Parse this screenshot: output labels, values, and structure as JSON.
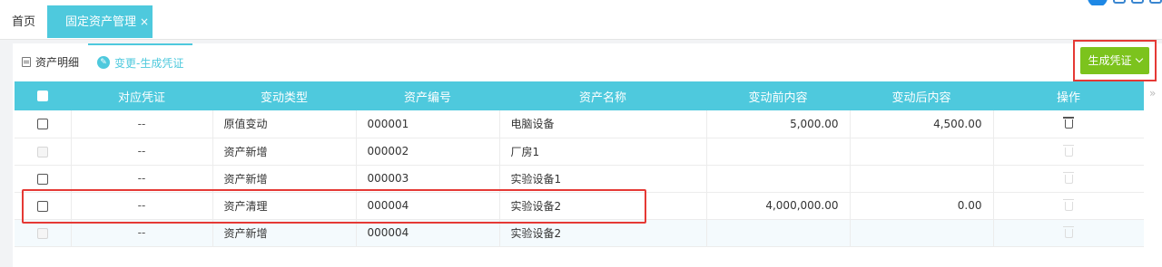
{
  "tabs": {
    "home_label": "首页",
    "active_label": "固定资产管理",
    "close_glyph": "×"
  },
  "subtabs": [
    {
      "label": "资产明细"
    },
    {
      "label": "变更-生成凭证"
    }
  ],
  "toolbar": {
    "generate_label": "生成凭证"
  },
  "table": {
    "headers": [
      "对应凭证",
      "变动类型",
      "资产编号",
      "资产名称",
      "变动前内容",
      "变动后内容",
      "操作"
    ],
    "rows": [
      {
        "voucher": "--",
        "type": "原值变动",
        "code": "000001",
        "name": "电脑设备",
        "before": "5,000.00",
        "after": "4,500.00",
        "enabled": true
      },
      {
        "voucher": "--",
        "type": "资产新增",
        "code": "000002",
        "name": "厂房1",
        "before": "",
        "after": "",
        "enabled": false
      },
      {
        "voucher": "--",
        "type": "资产新增",
        "code": "000003",
        "name": "实验设备1",
        "before": "",
        "after": "",
        "enabled": false
      },
      {
        "voucher": "--",
        "type": "资产清理",
        "code": "000004",
        "name": "实验设备2",
        "before": "4,000,000.00",
        "after": "0.00",
        "enabled": false
      },
      {
        "voucher": "--",
        "type": "资产新增",
        "code": "000004",
        "name": "实验设备2",
        "before": "",
        "after": "",
        "enabled": false
      }
    ]
  },
  "colors": {
    "accent": "#4ec9dd",
    "button": "#7cc31d",
    "highlight": "#e53935"
  }
}
